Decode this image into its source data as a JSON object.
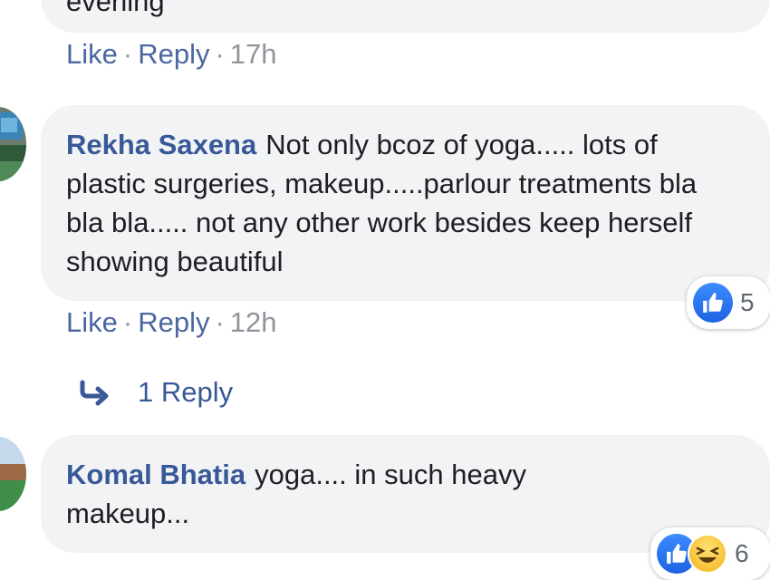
{
  "comment_prev": {
    "text_partial": "evening",
    "actions": {
      "like": "Like",
      "reply": "Reply",
      "time": "17h"
    }
  },
  "comment_rekha": {
    "author": "Rekha Saxena",
    "text": "Not only bcoz of yoga..... lots of plastic surgeries, makeup.....parlour treatments bla bla bla..... not any other work besides keep herself showing beautiful",
    "reaction_count": "5",
    "actions": {
      "like": "Like",
      "reply": "Reply",
      "time": "12h"
    },
    "replies_label": "1 Reply"
  },
  "comment_komal": {
    "author": "Komal Bhatia",
    "text": "yoga.... in such heavy makeup...",
    "reaction_count": "6"
  },
  "separator": "·",
  "icons": {
    "reply_arrow": "reply-arrow-icon",
    "like": "like-reaction-icon",
    "haha": "haha-reaction-icon"
  },
  "colors": {
    "author": "#385898",
    "link": "#4b67a1",
    "meta": "#90949c",
    "bubble": "#f2f3f5"
  }
}
